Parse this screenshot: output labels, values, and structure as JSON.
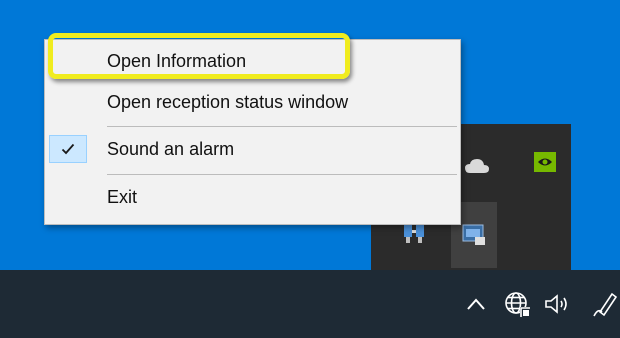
{
  "menu": {
    "items": [
      {
        "label": "Open Information",
        "checked": false
      },
      {
        "label": "Open reception status window",
        "checked": false
      },
      {
        "label": "Sound an alarm",
        "checked": true
      },
      {
        "label": "Exit",
        "checked": false
      }
    ]
  },
  "colors": {
    "desktop": "#0078d7",
    "taskbar": "#1e2a35",
    "highlight": "#f0ec1e",
    "menu_bg": "#f2f2f2"
  },
  "tray_icons": [
    "cloud-icon",
    "nvidia-icon",
    "network-icon",
    "app-icon"
  ],
  "taskbar_icons": [
    "chevron-up-icon",
    "globe-icon",
    "speaker-icon",
    "pen-icon"
  ]
}
